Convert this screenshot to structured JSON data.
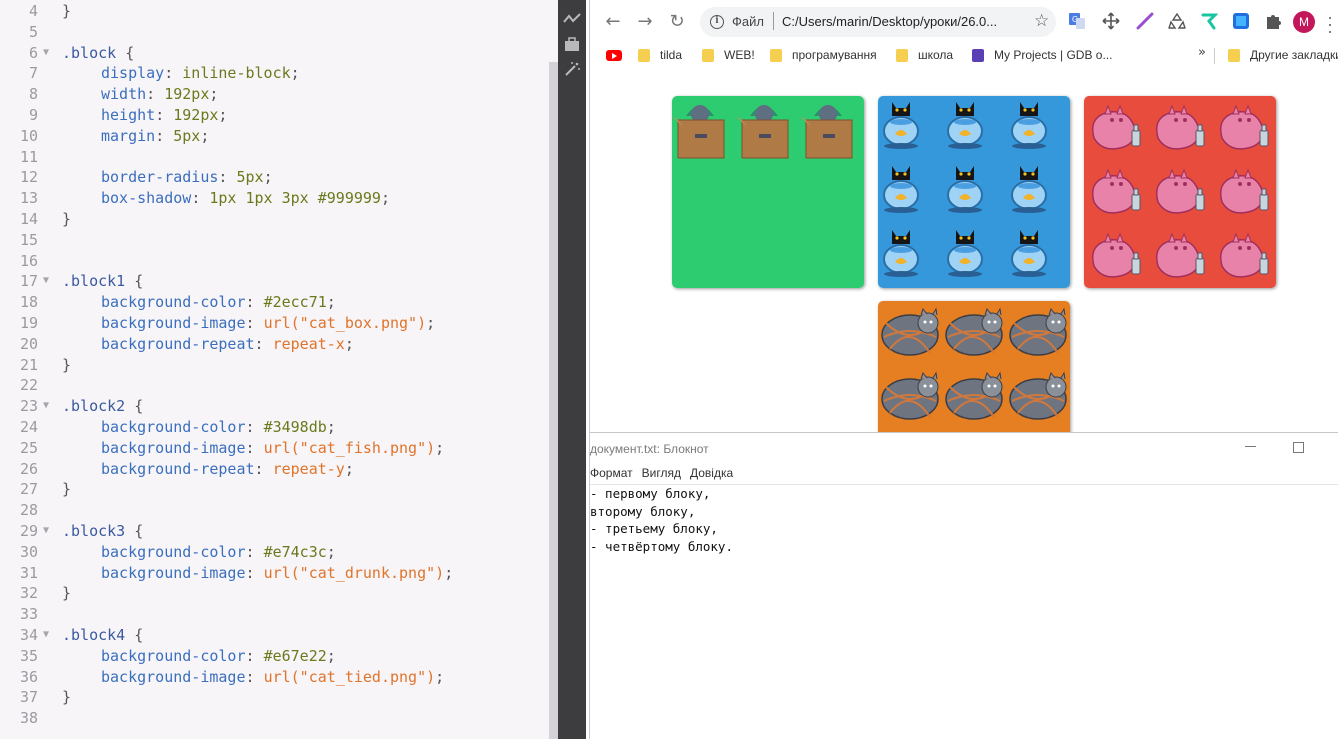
{
  "editor": {
    "lines": [
      {
        "n": "4",
        "fold": "",
        "indent": 0,
        "tokens": [
          {
            "t": "}",
            "c": "t-punc"
          }
        ]
      },
      {
        "n": "5",
        "fold": "",
        "indent": 0,
        "tokens": []
      },
      {
        "n": "6",
        "fold": "▼",
        "indent": 0,
        "tokens": [
          {
            "t": ".block",
            "c": "t-sel"
          },
          {
            "t": " {",
            "c": "t-punc"
          }
        ]
      },
      {
        "n": "7",
        "fold": "",
        "indent": 1,
        "tokens": [
          {
            "t": "display",
            "c": "t-prop"
          },
          {
            "t": ": ",
            "c": "t-punc"
          },
          {
            "t": "inline-block",
            "c": "t-val"
          },
          {
            "t": ";",
            "c": "t-punc"
          }
        ]
      },
      {
        "n": "8",
        "fold": "",
        "indent": 1,
        "tokens": [
          {
            "t": "width",
            "c": "t-prop"
          },
          {
            "t": ": ",
            "c": "t-punc"
          },
          {
            "t": "192px",
            "c": "t-val"
          },
          {
            "t": ";",
            "c": "t-punc"
          }
        ]
      },
      {
        "n": "9",
        "fold": "",
        "indent": 1,
        "tokens": [
          {
            "t": "height",
            "c": "t-prop"
          },
          {
            "t": ": ",
            "c": "t-punc"
          },
          {
            "t": "192px",
            "c": "t-val"
          },
          {
            "t": ";",
            "c": "t-punc"
          }
        ]
      },
      {
        "n": "10",
        "fold": "",
        "indent": 1,
        "tokens": [
          {
            "t": "margin",
            "c": "t-prop"
          },
          {
            "t": ": ",
            "c": "t-punc"
          },
          {
            "t": "5px",
            "c": "t-val"
          },
          {
            "t": ";",
            "c": "t-punc"
          }
        ]
      },
      {
        "n": "11",
        "fold": "",
        "indent": 0,
        "tokens": []
      },
      {
        "n": "12",
        "fold": "",
        "indent": 1,
        "tokens": [
          {
            "t": "border-radius",
            "c": "t-prop"
          },
          {
            "t": ": ",
            "c": "t-punc"
          },
          {
            "t": "5px",
            "c": "t-val"
          },
          {
            "t": ";",
            "c": "t-punc"
          }
        ]
      },
      {
        "n": "13",
        "fold": "",
        "indent": 1,
        "tokens": [
          {
            "t": "box-shadow",
            "c": "t-prop"
          },
          {
            "t": ": ",
            "c": "t-punc"
          },
          {
            "t": "1px 1px 3px #999999",
            "c": "t-val"
          },
          {
            "t": ";",
            "c": "t-punc"
          }
        ]
      },
      {
        "n": "14",
        "fold": "",
        "indent": 0,
        "tokens": [
          {
            "t": "}",
            "c": "t-punc"
          }
        ]
      },
      {
        "n": "15",
        "fold": "",
        "indent": 0,
        "tokens": []
      },
      {
        "n": "16",
        "fold": "",
        "indent": 0,
        "tokens": []
      },
      {
        "n": "17",
        "fold": "▼",
        "indent": 0,
        "tokens": [
          {
            "t": ".block1",
            "c": "t-sel"
          },
          {
            "t": " {",
            "c": "t-punc"
          }
        ]
      },
      {
        "n": "18",
        "fold": "",
        "indent": 1,
        "tokens": [
          {
            "t": "background-color",
            "c": "t-prop"
          },
          {
            "t": ": ",
            "c": "t-punc"
          },
          {
            "t": "#2ecc71",
            "c": "t-val"
          },
          {
            "t": ";",
            "c": "t-punc"
          }
        ]
      },
      {
        "n": "19",
        "fold": "",
        "indent": 1,
        "tokens": [
          {
            "t": "background-image",
            "c": "t-prop"
          },
          {
            "t": ": ",
            "c": "t-punc"
          },
          {
            "t": "url(\"cat_box.png\")",
            "c": "t-str"
          },
          {
            "t": ";",
            "c": "t-punc"
          }
        ]
      },
      {
        "n": "20",
        "fold": "",
        "indent": 1,
        "tokens": [
          {
            "t": "background-repeat",
            "c": "t-prop"
          },
          {
            "t": ": ",
            "c": "t-punc"
          },
          {
            "t": "repeat-x",
            "c": "t-str"
          },
          {
            "t": ";",
            "c": "t-punc"
          }
        ]
      },
      {
        "n": "21",
        "fold": "",
        "indent": 0,
        "tokens": [
          {
            "t": "}",
            "c": "t-punc"
          }
        ]
      },
      {
        "n": "22",
        "fold": "",
        "indent": 0,
        "tokens": []
      },
      {
        "n": "23",
        "fold": "▼",
        "indent": 0,
        "tokens": [
          {
            "t": ".block2",
            "c": "t-sel"
          },
          {
            "t": " {",
            "c": "t-punc"
          }
        ]
      },
      {
        "n": "24",
        "fold": "",
        "indent": 1,
        "tokens": [
          {
            "t": "background-color",
            "c": "t-prop"
          },
          {
            "t": ": ",
            "c": "t-punc"
          },
          {
            "t": "#3498db",
            "c": "t-val"
          },
          {
            "t": ";",
            "c": "t-punc"
          }
        ]
      },
      {
        "n": "25",
        "fold": "",
        "indent": 1,
        "tokens": [
          {
            "t": "background-image",
            "c": "t-prop"
          },
          {
            "t": ": ",
            "c": "t-punc"
          },
          {
            "t": "url(\"cat_fish.png\")",
            "c": "t-str"
          },
          {
            "t": ";",
            "c": "t-punc"
          }
        ]
      },
      {
        "n": "26",
        "fold": "",
        "indent": 1,
        "tokens": [
          {
            "t": "background-repeat",
            "c": "t-prop"
          },
          {
            "t": ": ",
            "c": "t-punc"
          },
          {
            "t": "repeat-y",
            "c": "t-str"
          },
          {
            "t": ";",
            "c": "t-punc"
          }
        ]
      },
      {
        "n": "27",
        "fold": "",
        "indent": 0,
        "tokens": [
          {
            "t": "}",
            "c": "t-punc"
          }
        ]
      },
      {
        "n": "28",
        "fold": "",
        "indent": 0,
        "tokens": []
      },
      {
        "n": "29",
        "fold": "▼",
        "indent": 0,
        "tokens": [
          {
            "t": ".block3",
            "c": "t-sel"
          },
          {
            "t": " {",
            "c": "t-punc"
          }
        ]
      },
      {
        "n": "30",
        "fold": "",
        "indent": 1,
        "tokens": [
          {
            "t": "background-color",
            "c": "t-prop"
          },
          {
            "t": ": ",
            "c": "t-punc"
          },
          {
            "t": "#e74c3c",
            "c": "t-val"
          },
          {
            "t": ";",
            "c": "t-punc"
          }
        ]
      },
      {
        "n": "31",
        "fold": "",
        "indent": 1,
        "tokens": [
          {
            "t": "background-image",
            "c": "t-prop"
          },
          {
            "t": ": ",
            "c": "t-punc"
          },
          {
            "t": "url(\"cat_drunk.png\")",
            "c": "t-str"
          },
          {
            "t": ";",
            "c": "t-punc"
          }
        ]
      },
      {
        "n": "32",
        "fold": "",
        "indent": 0,
        "tokens": [
          {
            "t": "}",
            "c": "t-punc"
          }
        ]
      },
      {
        "n": "33",
        "fold": "",
        "indent": 0,
        "tokens": []
      },
      {
        "n": "34",
        "fold": "▼",
        "indent": 0,
        "tokens": [
          {
            "t": ".block4",
            "c": "t-sel"
          },
          {
            "t": " {",
            "c": "t-punc"
          }
        ]
      },
      {
        "n": "35",
        "fold": "",
        "indent": 1,
        "tokens": [
          {
            "t": "background-color",
            "c": "t-prop"
          },
          {
            "t": ": ",
            "c": "t-punc"
          },
          {
            "t": "#e67e22",
            "c": "t-val"
          },
          {
            "t": ";",
            "c": "t-punc"
          }
        ]
      },
      {
        "n": "36",
        "fold": "",
        "indent": 1,
        "tokens": [
          {
            "t": "background-image",
            "c": "t-prop"
          },
          {
            "t": ": ",
            "c": "t-punc"
          },
          {
            "t": "url(\"cat_tied.png\")",
            "c": "t-str"
          },
          {
            "t": ";",
            "c": "t-punc"
          }
        ]
      },
      {
        "n": "37",
        "fold": "",
        "indent": 0,
        "tokens": [
          {
            "t": "}",
            "c": "t-punc"
          }
        ]
      },
      {
        "n": "38",
        "fold": "",
        "indent": 0,
        "tokens": []
      }
    ]
  },
  "browser": {
    "omnibox": {
      "scheme_label": "Файл",
      "url": "C:/Users/marin/Desktop/уроки/26.0..."
    },
    "avatar_letter": "M",
    "bookmarks": [
      {
        "label": "tilda"
      },
      {
        "label": "WEB!"
      },
      {
        "label": "програмування"
      },
      {
        "label": "школа"
      },
      {
        "label": "My Projects | GDB o..."
      }
    ],
    "more_bookmarks": "»",
    "other_bookmarks": "Другие закладки",
    "blocks": [
      {
        "name": "block1",
        "color": "#2ecc71",
        "image": "cat_box",
        "repeat": "repeat-x"
      },
      {
        "name": "block2",
        "color": "#3498db",
        "image": "cat_fish",
        "repeat": "repeat-y"
      },
      {
        "name": "block3",
        "color": "#e74c3c",
        "image": "cat_drunk",
        "repeat": "repeat"
      },
      {
        "name": "block4",
        "color": "#e67e22",
        "image": "cat_tied",
        "repeat": "repeat"
      }
    ]
  },
  "notepad": {
    "title": "документ.txt: Блокнот",
    "menu": [
      "Формат",
      "Вигляд",
      "Довідка"
    ],
    "lines": [
      "- первому блоку,",
      "второму блоку,",
      "- третьему блоку,",
      "- четвёртому блоку."
    ]
  },
  "colors": {
    "editor_bg": "#f7f5f8",
    "toolstrip_bg": "#3d3d3f",
    "selector": "#3a5aa0",
    "property": "#3b6fbe",
    "value": "#6a7a1c",
    "string": "#e0742a"
  },
  "icons": {
    "toolstrip": [
      "activity-icon",
      "toolbox-icon",
      "magic-wand-icon"
    ],
    "nav": [
      "back-arrow-icon",
      "forward-arrow-icon",
      "reload-icon",
      "info-icon",
      "star-icon",
      "menu-dots-icon"
    ],
    "extensions": [
      "translate-extension-icon",
      "move-extension-icon",
      "pen-extension-icon",
      "recycle-extension-icon",
      "gesture-extension-icon",
      "tile-extension-icon",
      "puzzle-extensions-icon"
    ]
  }
}
